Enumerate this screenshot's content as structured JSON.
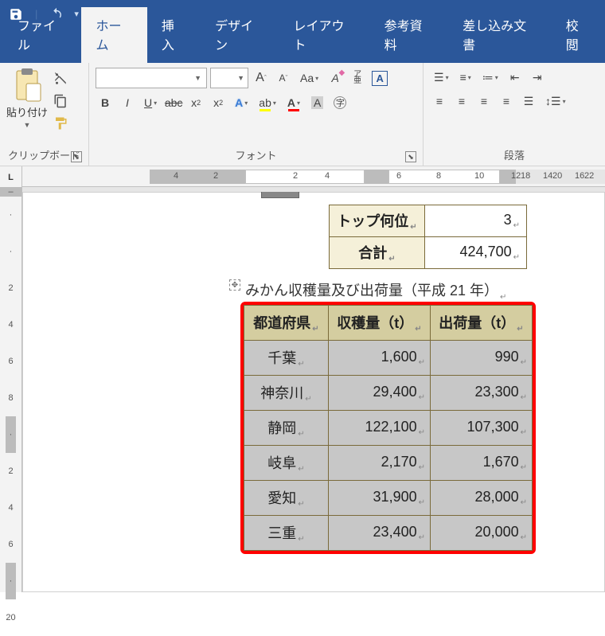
{
  "titlebar": {
    "save_icon": "save-icon",
    "undo_icon": "undo-icon",
    "redo_icon": "redo-icon"
  },
  "tabs": {
    "file": "ファイル",
    "home": "ホーム",
    "insert": "挿入",
    "design": "デザイン",
    "layout": "レイアウト",
    "references": "参考資料",
    "mailings": "差し込み文書",
    "review": "校閲"
  },
  "ribbon": {
    "clipboard": {
      "label": "クリップボード",
      "paste": "貼り付け"
    },
    "font": {
      "label": "フォント",
      "name": "",
      "size": ""
    },
    "paragraph": {
      "label": "段落"
    }
  },
  "hruler": [
    "4",
    "2",
    "2",
    "4",
    "6",
    "8",
    "10",
    "12",
    "14",
    "16",
    "18",
    "20",
    "22"
  ],
  "vruler": [
    "",
    "",
    "2",
    "4",
    "6",
    "8",
    "",
    "2",
    "4",
    "6",
    "",
    "20"
  ],
  "summary": {
    "top_label": "トップ何位",
    "top_value": "3",
    "total_label": "合計",
    "total_value": "424,700"
  },
  "caption": "みかん収穫量及び出荷量（平成 21 年）",
  "chart_data": {
    "type": "table",
    "headers": [
      "都道府県",
      "収穫量（t）",
      "出荷量（t）"
    ],
    "rows": [
      {
        "pref": "千葉",
        "harvest": "1,600",
        "ship": "990"
      },
      {
        "pref": "神奈川",
        "harvest": "29,400",
        "ship": "23,300"
      },
      {
        "pref": "静岡",
        "harvest": "122,100",
        "ship": "107,300"
      },
      {
        "pref": "岐阜",
        "harvest": "2,170",
        "ship": "1,670"
      },
      {
        "pref": "愛知",
        "harvest": "31,900",
        "ship": "28,000"
      },
      {
        "pref": "三重",
        "harvest": "23,400",
        "ship": "20,000"
      }
    ]
  }
}
